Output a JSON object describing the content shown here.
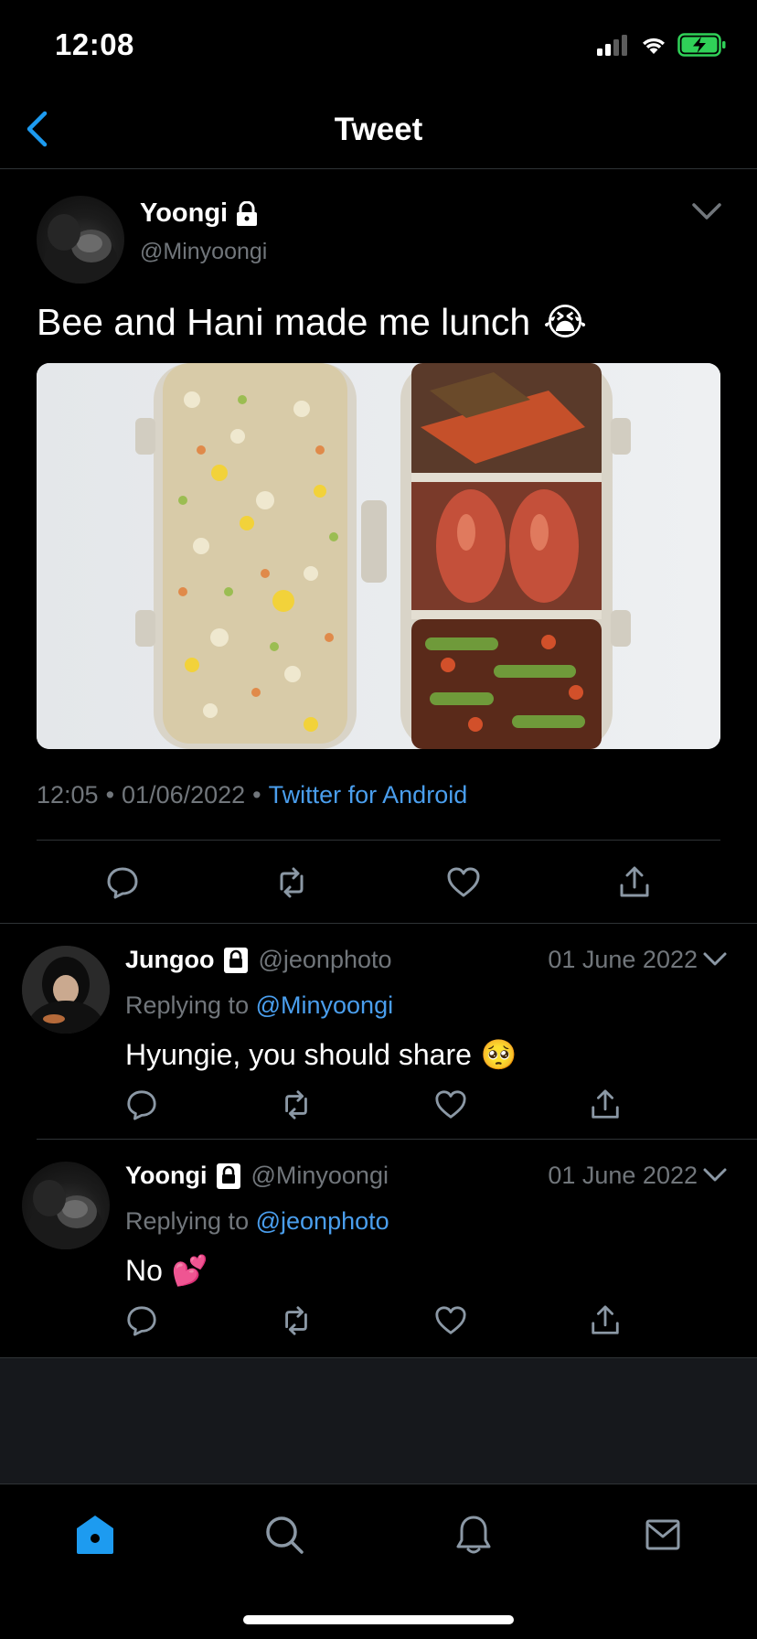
{
  "status_bar": {
    "time": "12:08"
  },
  "header": {
    "title": "Tweet"
  },
  "main_tweet": {
    "author_name": "Yoongi",
    "author_handle": "@Minyoongi",
    "text": "Bee and Hani made me lunch",
    "text_emoji": "😭",
    "time": "12:05",
    "date": "01/06/2022",
    "source": "Twitter for Android",
    "meta_sep": "•"
  },
  "replies": [
    {
      "author_name": "Jungoo",
      "author_handle": "@jeonphoto",
      "date": "01 June 2022",
      "replying_prefix": "Replying to",
      "replying_to": "@Minyoongi",
      "text": "Hyungie, you should share",
      "text_emoji": "🥺"
    },
    {
      "author_name": "Yoongi",
      "author_handle": "@Minyoongi",
      "date": "01 June 2022",
      "replying_prefix": "Replying to",
      "replying_to": "@jeonphoto",
      "text": "No",
      "text_emoji": "💕"
    }
  ],
  "tabs": [
    "home-icon",
    "search-icon",
    "notifications-icon",
    "messages-icon"
  ],
  "colors": {
    "accent": "#4a9eed",
    "muted": "#71767b",
    "background": "#000000",
    "battery": "#30d158"
  }
}
